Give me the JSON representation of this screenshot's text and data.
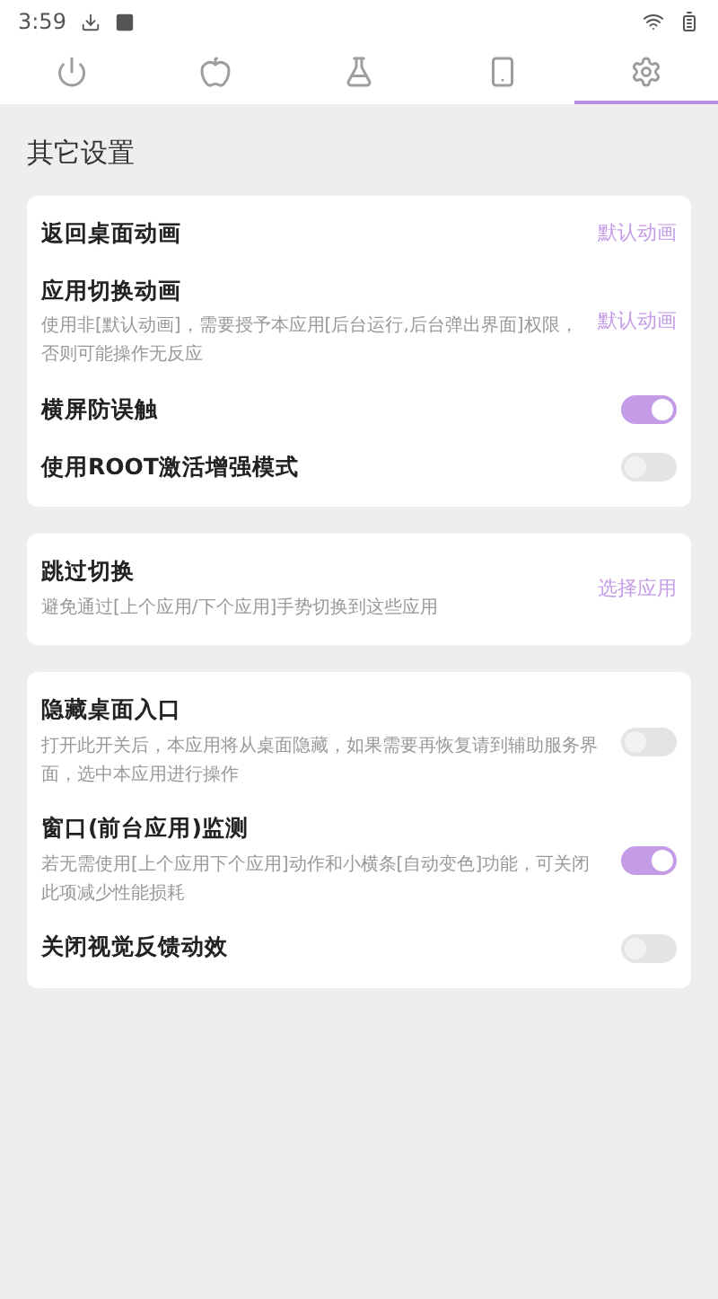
{
  "status_bar": {
    "time": "3:59"
  },
  "tabs": [
    {
      "kind": "power",
      "selected": false
    },
    {
      "kind": "apple",
      "selected": false
    },
    {
      "kind": "flask",
      "selected": false
    },
    {
      "kind": "phone",
      "selected": false
    },
    {
      "kind": "settings",
      "selected": true
    }
  ],
  "heading": "其它设置",
  "groups": [
    {
      "items": [
        {
          "kind": "value",
          "title": "返回桌面动画",
          "value": "默认动画"
        },
        {
          "kind": "value",
          "title": "应用切换动画",
          "description": "使用非[默认动画]，需要授予本应用[后台运行,后台弹出界面]权限，否则可能操作无反应",
          "value": "默认动画"
        },
        {
          "kind": "toggle",
          "title": "横屏防误触",
          "on": true
        },
        {
          "kind": "toggle",
          "title": "使用ROOT激活增强模式",
          "on": false
        }
      ]
    },
    {
      "items": [
        {
          "kind": "value",
          "title": "跳过切换",
          "description": "避免通过[上个应用/下个应用]手势切换到这些应用",
          "value": "选择应用"
        }
      ]
    },
    {
      "items": [
        {
          "kind": "toggle",
          "title": "隐藏桌面入口",
          "description": "打开此开关后，本应用将从桌面隐藏，如果需要再恢复请到辅助服务界面，选中本应用进行操作",
          "on": false
        },
        {
          "kind": "toggle",
          "title": "窗口(前台应用)监测",
          "description": "若无需使用[上个应用下个应用]动作和小横条[自动变色]功能，可关闭此项减少性能损耗",
          "on": true
        },
        {
          "kind": "toggle",
          "title": "关闭视觉反馈动效",
          "on": false
        }
      ]
    }
  ]
}
